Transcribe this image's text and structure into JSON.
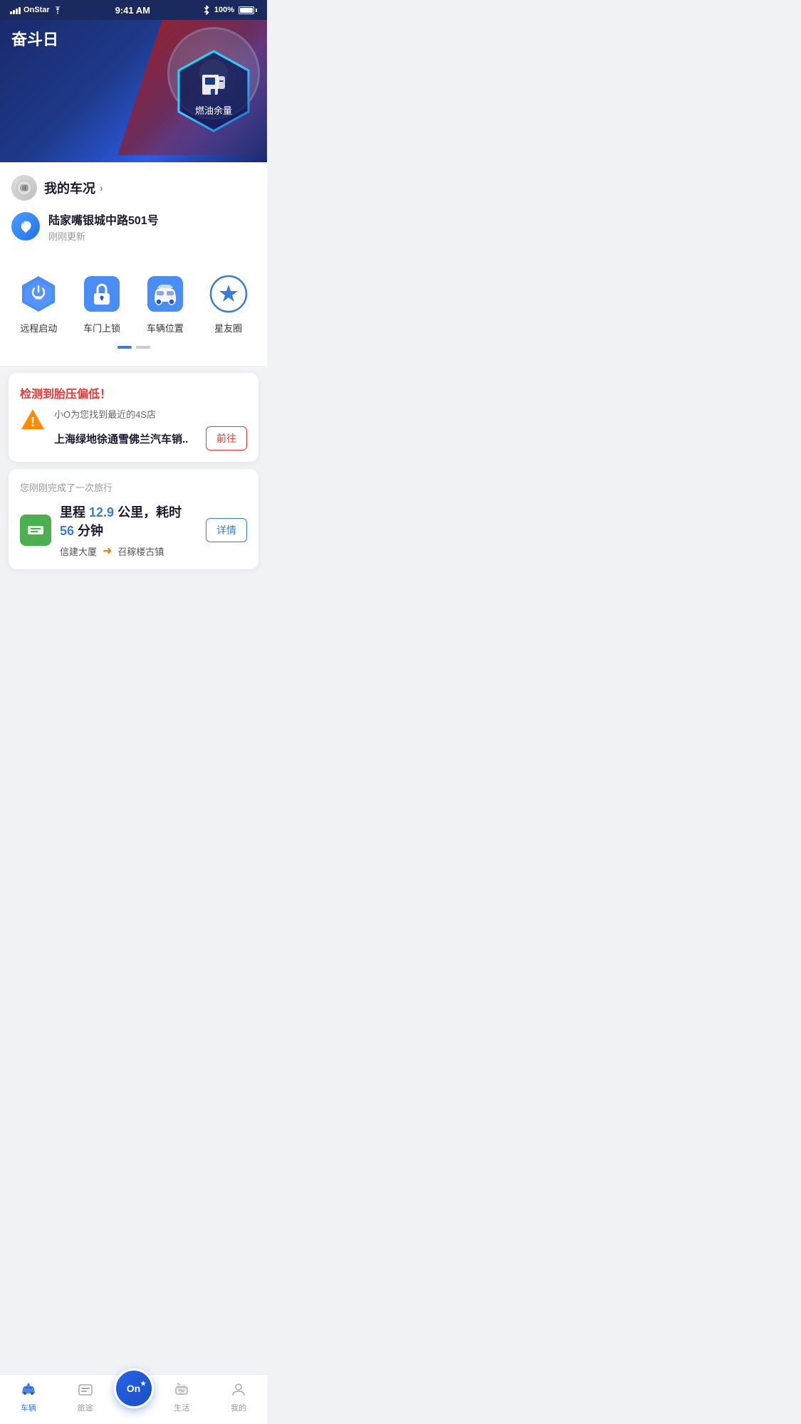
{
  "statusBar": {
    "carrier": "OnStar",
    "time": "9:41 AM",
    "battery": "100%"
  },
  "hero": {
    "title": "奋斗日",
    "fuelLabel": "燃油余量"
  },
  "carStatus": {
    "logoAlt": "Buick",
    "title": "我的车况",
    "chevron": "›",
    "location": "陆家嘴银城中路501号",
    "updateTime": "刚刚更新"
  },
  "quickActions": [
    {
      "id": "remote-start",
      "label": "远程启动",
      "type": "hex"
    },
    {
      "id": "door-lock",
      "label": "车门上锁",
      "type": "square"
    },
    {
      "id": "vehicle-location",
      "label": "车辆位置",
      "type": "car"
    },
    {
      "id": "star-circle",
      "label": "星友圈",
      "type": "star"
    }
  ],
  "pageIndicator": {
    "active": 0,
    "total": 2
  },
  "alertCard": {
    "title": "检测到胎压偏低！",
    "subtitle": "小O为您找到最近的4S店",
    "dealerName": "上海绿地徐通雪佛兰汽车销..",
    "buttonLabel": "前往"
  },
  "tripCard": {
    "header": "您刚刚完成了一次旅行",
    "distanceLabel": "里程",
    "distance": "12.9",
    "distanceUnit": "公里，耗时",
    "duration": "56",
    "durationUnit": "分钟",
    "from": "信建大厦",
    "to": "召稼楼古镇",
    "buttonLabel": "详情"
  },
  "tabBar": {
    "items": [
      {
        "id": "vehicle",
        "label": "车辆",
        "active": true
      },
      {
        "id": "journey",
        "label": "旅途",
        "active": false
      },
      {
        "id": "onstar",
        "label": "",
        "active": false,
        "center": true
      },
      {
        "id": "life",
        "label": "生活",
        "active": false
      },
      {
        "id": "mine",
        "label": "我的",
        "active": false
      }
    ]
  }
}
